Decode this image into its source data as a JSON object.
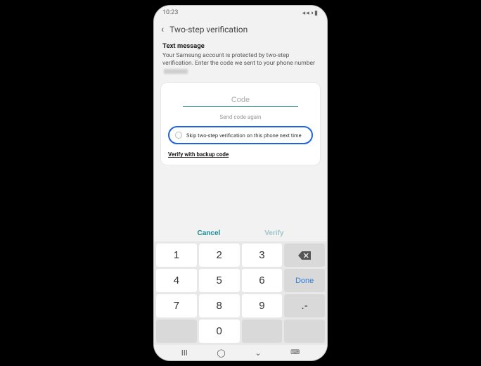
{
  "status": {
    "time": "10:23"
  },
  "header": {
    "title": "Two-step verification"
  },
  "section": {
    "title": "Text message",
    "desc_a": "Your Samsung account is protected by two-step verification. Enter the code we sent to your phone number"
  },
  "input": {
    "placeholder": "Code"
  },
  "links": {
    "send_again": "Send code again",
    "skip": "Skip two-step verification on this phone next time",
    "backup": "Verify with backup code"
  },
  "actions": {
    "cancel": "Cancel",
    "verify": "Verify"
  },
  "keypad": {
    "k1": "1",
    "k2": "2",
    "k3": "3",
    "k4": "4",
    "k5": "5",
    "k6": "6",
    "done": "Done",
    "k7": "7",
    "k8": "8",
    "k9": "9",
    "sym": ".-",
    "k0": "0"
  }
}
